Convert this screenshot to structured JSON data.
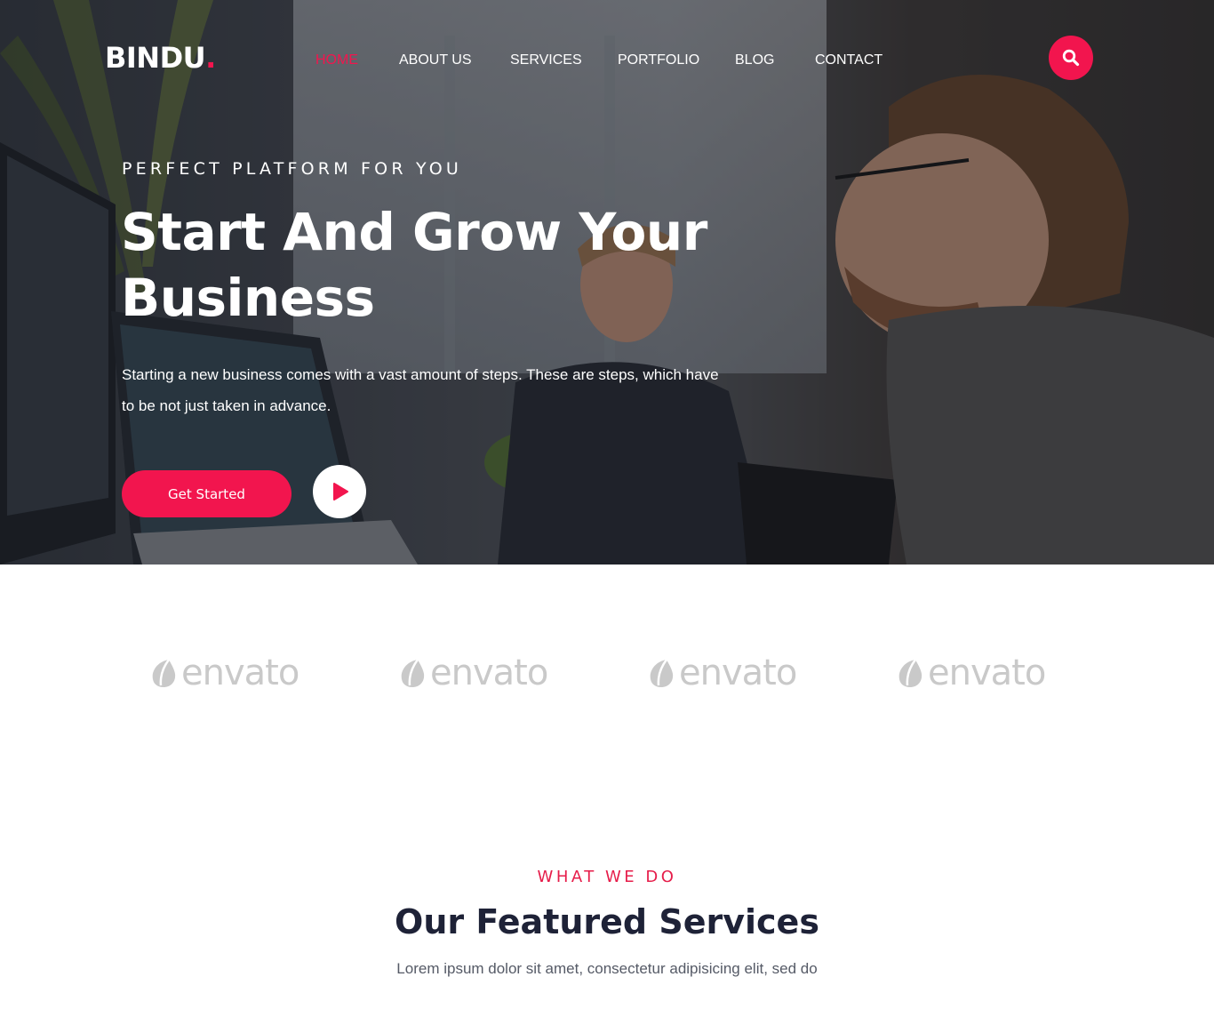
{
  "header": {
    "logo_text": "BINDU",
    "logo_dot": ".",
    "nav": [
      {
        "label": "HOME",
        "active": true
      },
      {
        "label": "ABOUT US",
        "active": false
      },
      {
        "label": "SERVICES",
        "active": false
      },
      {
        "label": "PORTFOLIO",
        "active": false
      },
      {
        "label": "BLOG",
        "active": false
      },
      {
        "label": "CONTACT",
        "active": false
      }
    ],
    "search_icon": "search-icon"
  },
  "hero": {
    "eyebrow": "PERFECT PLATFORM FOR YOU",
    "headline_line1": "Start And Grow Your",
    "headline_line2": "Business",
    "lead": "Starting a new business comes with a vast amount of steps. These are steps, which have to be not just taken in advance.",
    "cta_label": "Get Started",
    "play_icon": "play-icon"
  },
  "brands": [
    "envato",
    "envato",
    "envato",
    "envato"
  ],
  "services": {
    "eyebrow": "WHAT WE DO",
    "title": "Our Featured Services",
    "description": "Lorem ipsum dolor sit amet, consectetur adipisicing elit, sed do"
  },
  "colors": {
    "accent": "#f2154e",
    "heading_dark": "#1e2237",
    "brand_gray": "#c9c9c9"
  }
}
